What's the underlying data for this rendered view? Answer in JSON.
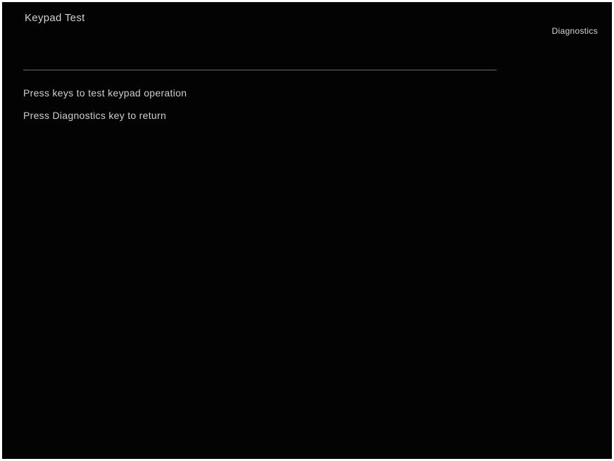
{
  "screen": {
    "title": "Keypad Test",
    "softkey_label": "Diagnostics",
    "instructions": [
      "Press keys to test keypad operation",
      "Press Diagnostics key to return"
    ]
  },
  "colors": {
    "background": "#030303",
    "text": "#cfcfcf",
    "divider": "#6a6a6a"
  }
}
